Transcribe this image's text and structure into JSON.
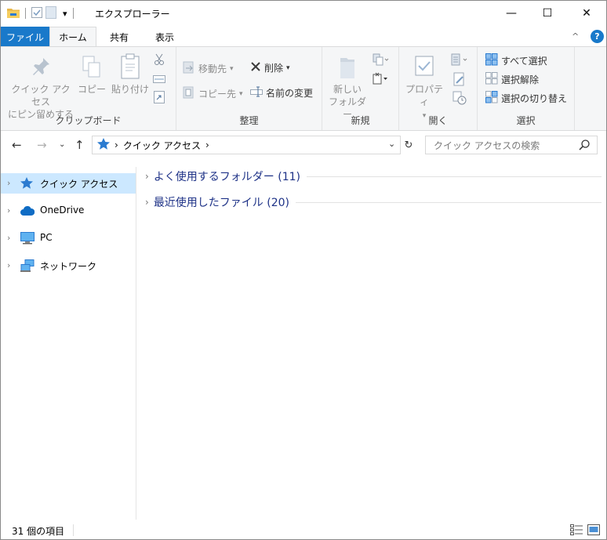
{
  "titlebar": {
    "title": "エクスプローラー",
    "qat_dropdown": "▾",
    "minimize": "—",
    "maximize": "☐",
    "close": "✕"
  },
  "tabs": {
    "file": "ファイル",
    "home": "ホーム",
    "share": "共有",
    "view": "表示",
    "collapse": "^",
    "help": "?"
  },
  "ribbon": {
    "clipboard": {
      "label": "クリップボード",
      "pin_line1": "クイック アクセス",
      "pin_line2": "にピン留めする",
      "copy": "コピー",
      "paste": "貼り付け"
    },
    "organize": {
      "label": "整理",
      "move_to": "移動先",
      "copy_to": "コピー先",
      "delete": "削除",
      "rename": "名前の変更"
    },
    "new": {
      "label": "新規",
      "new_folder_line1": "新しい",
      "new_folder_line2": "フォルダー"
    },
    "open": {
      "label": "開く",
      "properties": "プロパティ"
    },
    "select": {
      "label": "選択",
      "select_all": "すべて選択",
      "select_none": "選択解除",
      "invert": "選択の切り替え"
    }
  },
  "address": {
    "path": "クイック アクセス",
    "search_placeholder": "クイック アクセスの検索"
  },
  "navpane": {
    "items": [
      {
        "label": "クイック アクセス",
        "icon": "star-icon"
      },
      {
        "label": "OneDrive",
        "icon": "cloud-icon"
      },
      {
        "label": "PC",
        "icon": "monitor-icon"
      },
      {
        "label": "ネットワーク",
        "icon": "network-icon"
      }
    ]
  },
  "content": {
    "groups": [
      {
        "label": "よく使用するフォルダー (11)"
      },
      {
        "label": "最近使用したファイル (20)"
      }
    ]
  },
  "status": {
    "item_count": "31 個の項目"
  },
  "colors": {
    "accent": "#1979ca",
    "selection": "#cce8ff",
    "group_header": "#1e3287"
  }
}
